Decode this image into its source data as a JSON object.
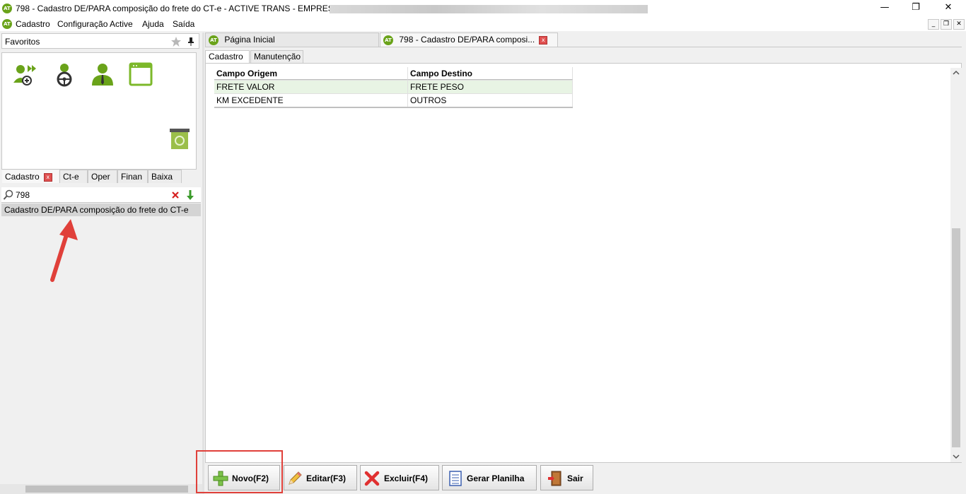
{
  "window": {
    "title": "798 - Cadastro DE/PARA composição do frete do CT-e - ACTIVE TRANS - EMPRESA: V",
    "logo_text": "AT",
    "controls": {
      "minimize": "—",
      "maximize": "❐",
      "close": "✕"
    }
  },
  "menu": {
    "items": [
      "Cadastro",
      "Configuração Active",
      "Ajuda",
      "Saída"
    ],
    "mdi": {
      "minimize": "_",
      "restore": "❐",
      "close": "✕"
    }
  },
  "favorites": {
    "label": "Favoritos",
    "icons": [
      "user-add-icon",
      "driver-wheel-icon",
      "user-suit-icon",
      "window-icon"
    ],
    "trash_icon": "recycle-bin-icon"
  },
  "left_tabs": [
    {
      "label": "Cadastro",
      "active": true,
      "closable": true
    },
    {
      "label": "Ct-e"
    },
    {
      "label": "Oper"
    },
    {
      "label": "Finan"
    },
    {
      "label": "Baixa"
    }
  ],
  "search": {
    "value": "798"
  },
  "results": [
    {
      "label": "Cadastro DE/PARA composição do frete do CT-e"
    }
  ],
  "doc_tabs": [
    {
      "label": "Página Inicial"
    },
    {
      "label": "798 - Cadastro DE/PARA composi...",
      "active": true,
      "closable": true
    }
  ],
  "inner_tabs": [
    {
      "label": "Cadastro",
      "active": true
    },
    {
      "label": "Manutenção"
    }
  ],
  "grid": {
    "columns": [
      "Campo Origem",
      "Campo Destino"
    ],
    "rows": [
      [
        "FRETE VALOR",
        "FRETE PESO"
      ],
      [
        "KM EXCEDENTE",
        "OUTROS"
      ]
    ]
  },
  "buttons": {
    "novo": "Novo(F2)",
    "editar": "Editar(F3)",
    "excluir": "Excluir(F4)",
    "gerar": "Gerar Planilha",
    "sair": "Sair"
  },
  "colors": {
    "accent_green": "#6aa31a",
    "annotation_red": "#e0403a",
    "selected_row": "#e8f4e4"
  }
}
